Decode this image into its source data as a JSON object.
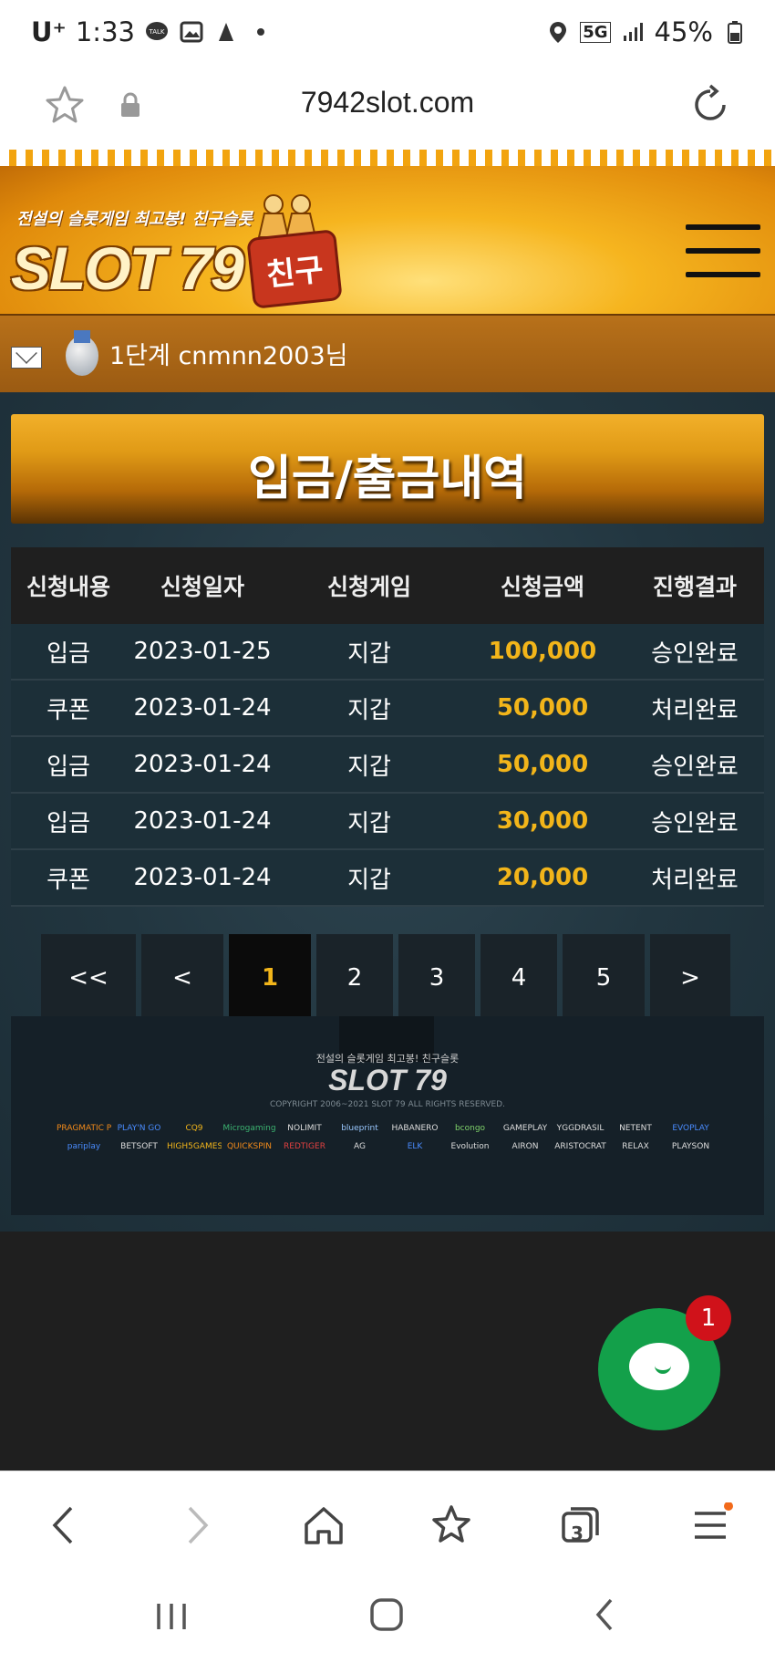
{
  "status_bar": {
    "carrier": "U⁺",
    "time": "1:33",
    "network": "5G",
    "battery": "45%",
    "icons": [
      "talk-icon",
      "gallery-icon",
      "app-icon",
      "dot-icon",
      "location-icon",
      "signal-icon",
      "battery-icon"
    ]
  },
  "browser": {
    "url": "7942slot.com",
    "tab_count": "3"
  },
  "site": {
    "logo_tagline": "전설의 슬롯게임 최고봉! 친구슬롯",
    "logo_name": "SLOT 79",
    "logo_badge": "친구",
    "user_text": "1단계 cnmnn2003님",
    "page_title": "입금/출금내역",
    "table": {
      "headers": [
        "신청내용",
        "신청일자",
        "신청게임",
        "신청금액",
        "진행결과"
      ],
      "rows": [
        [
          "입금",
          "2023-01-25",
          "지갑",
          "100,000",
          "승인완료"
        ],
        [
          "쿠폰",
          "2023-01-24",
          "지갑",
          "50,000",
          "처리완료"
        ],
        [
          "입금",
          "2023-01-24",
          "지갑",
          "50,000",
          "승인완료"
        ],
        [
          "입금",
          "2023-01-24",
          "지갑",
          "30,000",
          "승인완료"
        ],
        [
          "쿠폰",
          "2023-01-24",
          "지갑",
          "20,000",
          "처리완료"
        ]
      ]
    },
    "pagination": [
      "<<",
      "<",
      "1",
      "2",
      "3",
      "4",
      "5",
      ">"
    ],
    "active_page": "1",
    "footer": {
      "logo_tagline": "전설의 슬롯게임 최고봉! 친구슬롯",
      "logo_name": "SLOT 79",
      "copyright": "COPYRIGHT 2006~2021 SLOT 79 ALL RIGHTS RESERVED.",
      "providers_row1": [
        "PRAGMATIC PLAY",
        "PLAY'N GO",
        "CQ9",
        "Microgaming",
        "NOLIMIT",
        "blueprint",
        "HABANERO",
        "bcongo",
        "GAMEPLAY",
        "YGGDRASIL",
        "NETENT",
        "EVOPLAY"
      ],
      "providers_row2": [
        "pariplay",
        "BETSOFT",
        "HIGH5GAMES",
        "QUICKSPIN",
        "REDTIGER",
        "AG",
        "ELK",
        "Evolution",
        "AIRON",
        "ARISTOCRAT",
        "RELAX",
        "PLAYSON"
      ]
    },
    "chat_badge": "1"
  },
  "colors": {
    "accent_gold": "#f2b51a",
    "chat_green": "#13a04a",
    "badge_red": "#d0121a"
  }
}
